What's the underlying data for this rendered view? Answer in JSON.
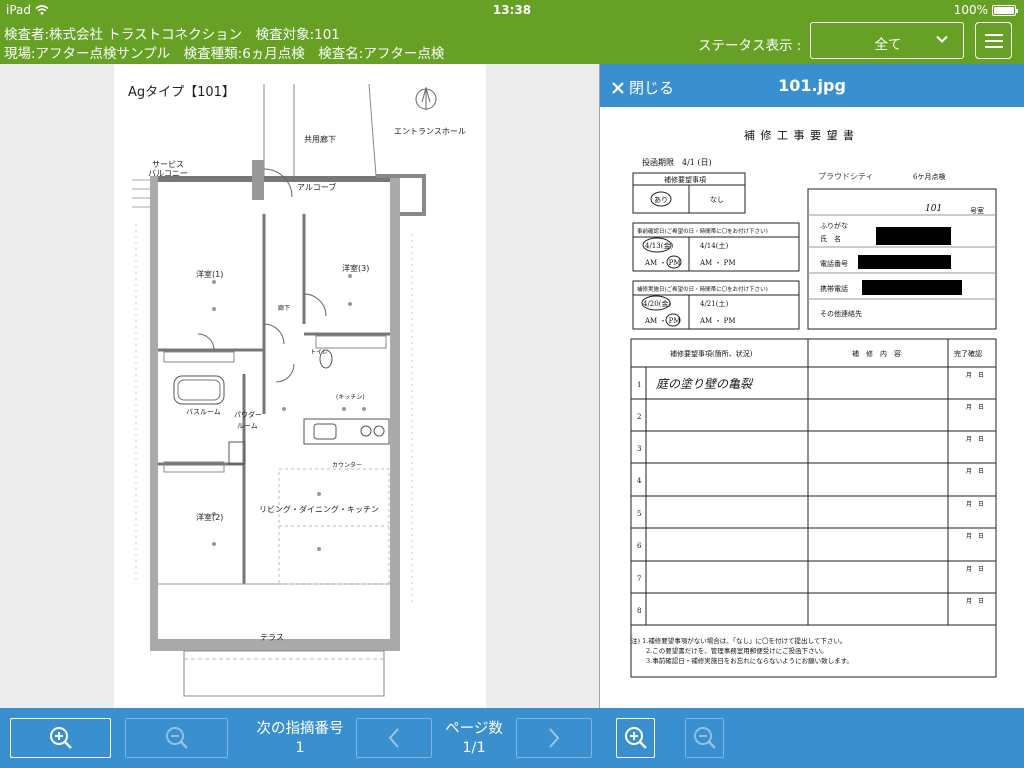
{
  "status_bar": {
    "device": "iPad",
    "time": "13:38",
    "battery": "100%"
  },
  "header": {
    "line1": "検査者:株式会社 トラストコネクション　検査対象:101",
    "line2": "現場:アフター点検サンプル　検査種類:6ヵ月点検　検査名:アフター点検",
    "status_label": "ステータス表示 :",
    "status_value": "全て"
  },
  "floor_plan": {
    "title": "Agタイプ【101】",
    "rooms": {
      "common_corridor": "共用廊下",
      "entrance_hall": "エントランスホール",
      "service_balcony_1": "サービス",
      "service_balcony_2": "バルコニー",
      "alcove": "アルコーブ",
      "western1": "洋室(1)",
      "western3": "洋室(3)",
      "corridor": "廊下",
      "toilet": "トイレ",
      "kitchen": "(キッチン)",
      "bathroom": "バスルーム",
      "powder_1": "パウダー",
      "powder_2": "ルーム",
      "western2": "洋室(2)",
      "ldk": "リビング・ダイニング・キッチン",
      "terrace": "テラス",
      "counter": "カウンター"
    }
  },
  "viewer": {
    "close_label": "閉じる",
    "filename": "101.jpg",
    "document": {
      "title": "補 修 工 事 要 望 書",
      "deadline": "投函期限　4/1 (日)",
      "request_items": "補修要望事項",
      "yes": "あり",
      "no": "なし",
      "pre_check": "事前確認日(ご希望の日・時間帯に〇をお付け下さい)",
      "date1": "4/13(金)",
      "date2": "4/14(土)",
      "am_pm": "AM ・ PM",
      "impl_date": "補修実施日(ご希望の日・時間帯に〇をお付け下さい)",
      "date3": "4/20(金)",
      "date4": "4/21(土)",
      "hw_name": "プラウドシティ",
      "hw_room": "101",
      "six_month": "6ケ月点検",
      "room_no": "号室",
      "furigana": "ふりがな",
      "name": "氏　名",
      "phone": "電話番号",
      "mobile": "携帯電話",
      "other_contact": "その他連絡先",
      "col_item": "補修要望事項(箇所、状況)",
      "col_content": "補　修　内　容",
      "col_done": "完了確認",
      "month_day": "月　日",
      "row1_hand": "庭の塗り壁の亀裂",
      "note1": "注) 1.補修要望事項がない場合は、「なし」に〇を付けて提出して下さい。",
      "note2": "2.この要望書だけを、管理事務室用郵便受けにご投函下さい。",
      "note3": "3.事前確認日・補修実施日をお忘れにならないようにお願い致します。"
    }
  },
  "toolbar": {
    "next_issue_label": "次の指摘番号",
    "next_issue_value": "1",
    "page_label": "ページ数",
    "page_value": "1/1"
  }
}
